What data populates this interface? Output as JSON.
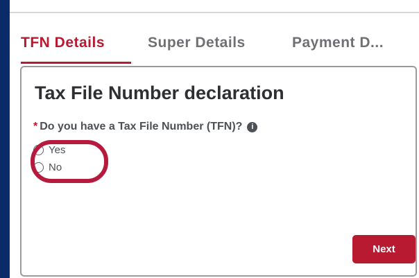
{
  "tabs": [
    {
      "label": "TFN Details",
      "active": true
    },
    {
      "label": "Super Details",
      "active": false
    },
    {
      "label": "Payment D...",
      "active": false
    }
  ],
  "card": {
    "title": "Tax File Number declaration",
    "question": {
      "required_marker": "*",
      "text": "Do you have a Tax File Number (TFN)?",
      "info_icon": "info-icon"
    },
    "options": [
      {
        "label": "Yes",
        "selected": false
      },
      {
        "label": "No",
        "selected": false
      }
    ],
    "next_label": "Next"
  },
  "colors": {
    "accent": "#b81a31",
    "highlight": "#b61b3d",
    "background": "#0b2a6a"
  }
}
